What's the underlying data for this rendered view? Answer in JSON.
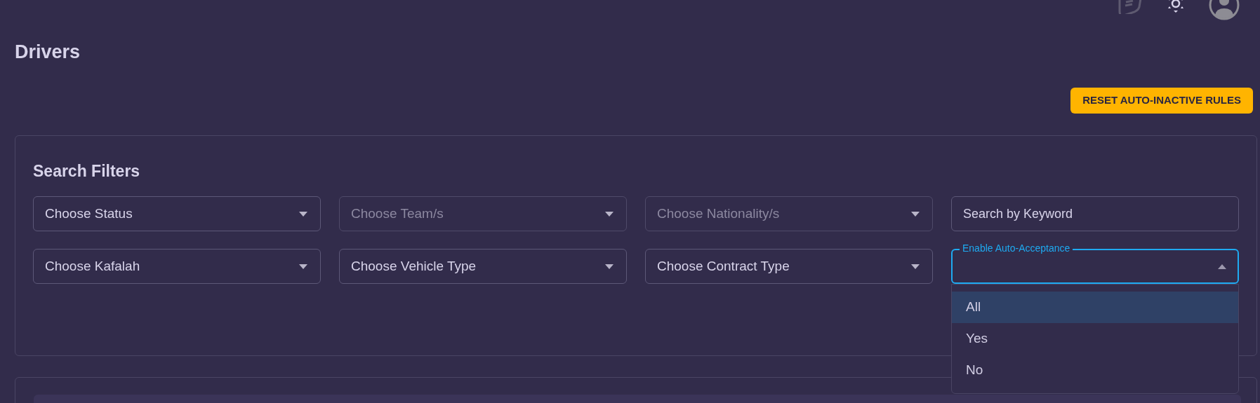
{
  "page": {
    "title": "Drivers"
  },
  "actions": [
    {
      "label": "RESET AUTO-INACTIVE RULES"
    }
  ],
  "filters": {
    "title": "Search Filters",
    "fields": [
      {
        "kind": "select",
        "label": "Choose Status",
        "disabled": false,
        "open": false
      },
      {
        "kind": "select",
        "label": "Choose Team/s",
        "disabled": true,
        "open": false
      },
      {
        "kind": "select",
        "label": "Choose Nationality/s",
        "disabled": true,
        "open": false
      },
      {
        "kind": "text",
        "placeholder": "Search by Keyword"
      },
      {
        "kind": "select",
        "label": "Choose Kafalah",
        "disabled": false,
        "open": false
      },
      {
        "kind": "select",
        "label": "Choose Vehicle Type",
        "disabled": false,
        "open": false
      },
      {
        "kind": "select",
        "label": "Choose Contract Type",
        "disabled": false,
        "open": false
      },
      {
        "kind": "select",
        "label": "Enable Auto-Acceptance",
        "open": true,
        "options": [
          {
            "label": "All",
            "selected": true
          },
          {
            "label": "Yes",
            "selected": false
          },
          {
            "label": "No",
            "selected": false
          }
        ]
      }
    ]
  }
}
